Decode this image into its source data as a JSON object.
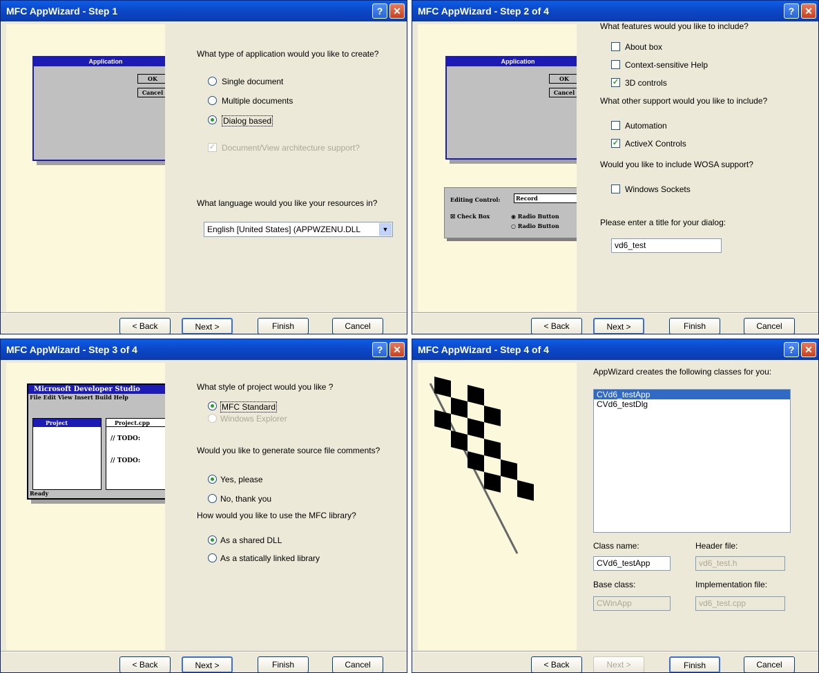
{
  "buttons": {
    "back": "< Back",
    "next": "Next >",
    "finish": "Finish",
    "cancel": "Cancel"
  },
  "step1": {
    "title": "MFC AppWizard - Step 1",
    "illustration": {
      "caption": "Application",
      "ok": "OK",
      "cancel": "Cancel"
    },
    "question": "What type of application would you like to create?",
    "options": [
      "Single document",
      "Multiple documents",
      "Dialog based"
    ],
    "selected": "Dialog based",
    "docview": "Document/View architecture support?",
    "language_question": "What language would you like your resources in?",
    "language_value": "English [United States] (APPWZENU.DLL"
  },
  "step2": {
    "title": "MFC AppWizard - Step 2 of 4",
    "illustration": {
      "caption": "Application",
      "ok": "OK",
      "cancel": "Cancel",
      "editing_label": "Editing Control:",
      "editing_value": "Record",
      "check_box": "Check Box",
      "radio1": "Radio Button",
      "radio2": "Radio Button"
    },
    "features_question": "What features would you like to include?",
    "about_box": "About box",
    "context_help": "Context-sensitive Help",
    "controls_3d": "3D controls",
    "support_question": "What other support would you like to include?",
    "automation": "Automation",
    "activex": "ActiveX Controls",
    "wosa_question": "Would you like to include WOSA support?",
    "sockets": "Windows Sockets",
    "title_prompt": "Please enter a title for your dialog:",
    "title_value": "vd6_test"
  },
  "step3": {
    "title": "MFC AppWizard - Step 3 of 4",
    "illustration": {
      "app": "Microsoft Developer Studio",
      "menu": "File Edit View Insert Build Help",
      "project": "Project",
      "file": "Project.cpp",
      "todo": "// TODO:",
      "status": "Ready"
    },
    "style_question": "What style of project would you like ?",
    "mfc_standard": "MFC Standard",
    "explorer": "Windows Explorer",
    "comments_question": "Would you like to generate source file comments?",
    "yes": "Yes, please",
    "no": "No, thank you",
    "library_question": "How would you like to use the MFC library?",
    "shared": "As a shared DLL",
    "static": "As a statically linked library"
  },
  "step4": {
    "title": "MFC AppWizard - Step 4 of 4",
    "classes_label": "AppWizard creates the following classes for you:",
    "classes": [
      "CVd6_testApp",
      "CVd6_testDlg"
    ],
    "class_name_label": "Class name:",
    "class_name": "CVd6_testApp",
    "header_label": "Header file:",
    "header": "vd6_test.h",
    "base_label": "Base class:",
    "base": "CWinApp",
    "impl_label": "Implementation file:",
    "impl": "vd6_test.cpp"
  }
}
